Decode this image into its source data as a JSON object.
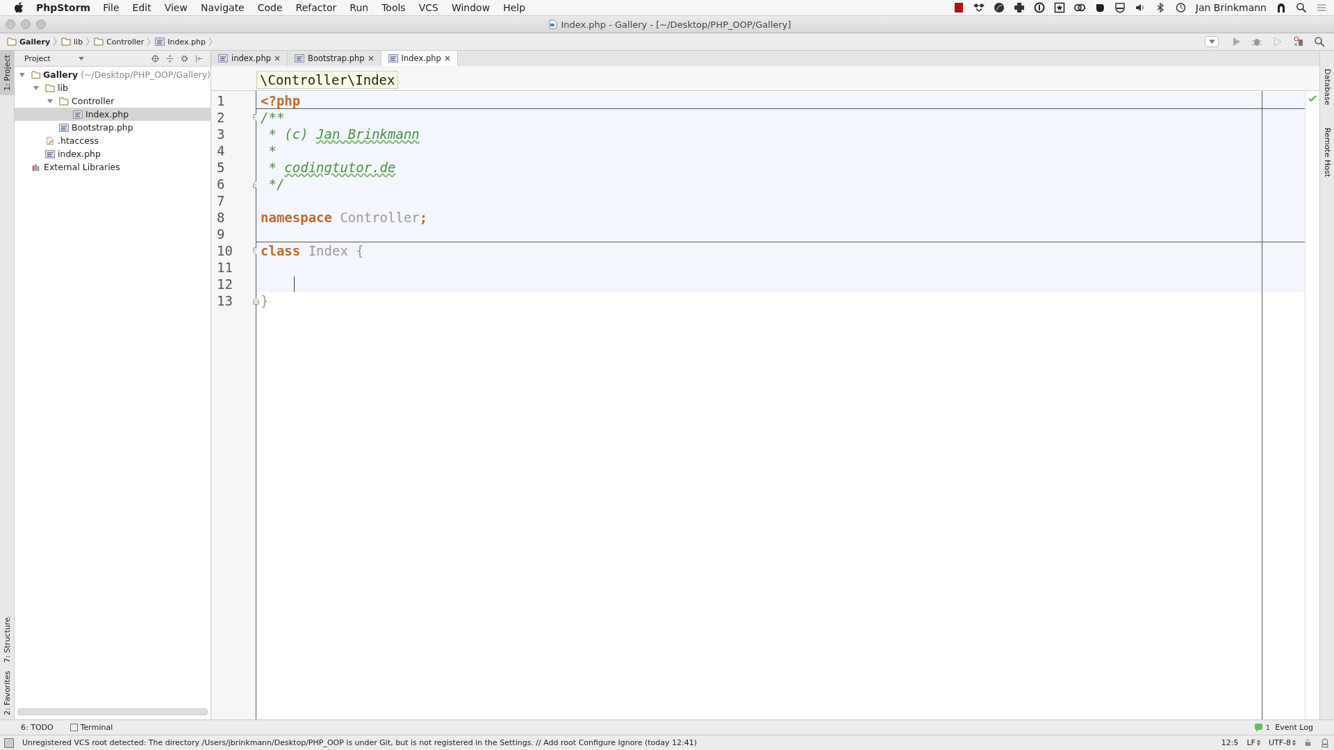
{
  "menu_bar": {
    "app": "PhpStorm",
    "menus": [
      "File",
      "Edit",
      "View",
      "Navigate",
      "Code",
      "Refactor",
      "Run",
      "Tools",
      "VCS",
      "Window",
      "Help"
    ],
    "user": "Jan Brinkmann"
  },
  "window": {
    "title": "Index.php - Gallery - [~/Desktop/PHP_OOP/Gallery]"
  },
  "breadcrumbs": [
    {
      "label": "Gallery",
      "bold": true
    },
    {
      "label": "lib",
      "bold": false
    },
    {
      "label": "Controller",
      "bold": false
    },
    {
      "label": "Index.php",
      "bold": false
    }
  ],
  "left_strip": [
    "1: Project",
    "7: Structure",
    "2: Favorites"
  ],
  "right_strip": [
    "Database",
    "Remote Host"
  ],
  "project_panel": {
    "view": "Project",
    "tree": [
      {
        "label": "Gallery",
        "hint": "(~/Desktop/PHP_OOP/Gallery)",
        "kind": "folder",
        "expanded": true,
        "selected": false,
        "children": [
          {
            "label": "lib",
            "kind": "folder",
            "expanded": true,
            "selected": false,
            "children": [
              {
                "label": "Controller",
                "kind": "folder",
                "expanded": true,
                "selected": false,
                "children": [
                  {
                    "label": "Index.php",
                    "kind": "php",
                    "selected": true
                  }
                ]
              },
              {
                "label": "Bootstrap.php",
                "kind": "php",
                "selected": false
              }
            ]
          },
          {
            "label": ".htaccess",
            "kind": "file",
            "selected": false
          },
          {
            "label": "index.php",
            "kind": "php",
            "selected": false
          }
        ]
      },
      {
        "label": "External Libraries",
        "kind": "library",
        "selected": false
      }
    ]
  },
  "tabs": [
    {
      "label": "index.php",
      "selected": false
    },
    {
      "label": "Bootstrap.php",
      "selected": false
    },
    {
      "label": "Index.php",
      "selected": true
    }
  ],
  "editor": {
    "scope": "\\Controller\\Index",
    "lines": [
      {
        "number": "1",
        "fold_start": false,
        "fold_end": false,
        "caret": false,
        "tokens": [
          {
            "text": "<?php",
            "kind": "keyword"
          }
        ]
      },
      {
        "number": "2",
        "fold_start": true,
        "fold_end": false,
        "caret": false,
        "tokens": [
          {
            "text": "/**",
            "kind": "comment"
          }
        ]
      },
      {
        "number": "3",
        "fold_start": false,
        "fold_end": false,
        "caret": false,
        "tokens": [
          {
            "text": " * (c) ",
            "kind": "comment"
          },
          {
            "text": "Jan Brinkmann",
            "kind": "typo"
          }
        ]
      },
      {
        "number": "4",
        "fold_start": false,
        "fold_end": false,
        "caret": false,
        "tokens": [
          {
            "text": " *",
            "kind": "comment"
          }
        ]
      },
      {
        "number": "5",
        "fold_start": false,
        "fold_end": false,
        "caret": false,
        "tokens": [
          {
            "text": " * ",
            "kind": "comment"
          },
          {
            "text": "codingtutor.de",
            "kind": "typo"
          }
        ]
      },
      {
        "number": "6",
        "fold_start": false,
        "fold_end": true,
        "caret": false,
        "tokens": [
          {
            "text": " */",
            "kind": "comment"
          }
        ]
      },
      {
        "number": "7",
        "fold_start": false,
        "fold_end": false,
        "caret": false
      },
      {
        "number": "8",
        "fold_start": false,
        "fold_end": false,
        "caret": false,
        "tokens": [
          {
            "text": "namespace",
            "kind": "keyword"
          },
          {
            "text": " Controller",
            "kind": "name"
          },
          {
            "text": ";",
            "kind": "keyword"
          }
        ]
      },
      {
        "number": "9",
        "fold_start": false,
        "fold_end": false,
        "caret": false
      },
      {
        "number": "10",
        "fold_start": true,
        "fold_end": false,
        "caret": false,
        "tokens": [
          {
            "text": "class",
            "kind": "keyword"
          },
          {
            "text": " Index {",
            "kind": "name"
          }
        ]
      },
      {
        "number": "11",
        "fold_start": false,
        "fold_end": false,
        "caret": false
      },
      {
        "number": "12",
        "fold_start": false,
        "fold_end": false,
        "caret": true
      },
      {
        "number": "13",
        "fold_start": false,
        "fold_end": true,
        "caret": false,
        "tokens": [
          {
            "text": "}",
            "kind": "name"
          }
        ]
      }
    ]
  },
  "tool_bar": {
    "tools": [
      "6: TODO",
      "Terminal"
    ],
    "event_count": "1",
    "event_log": "Event Log"
  },
  "status_bar": {
    "message": "Unregistered VCS root detected: The directory /Users/jbrinkmann/Desktop/PHP_OOP is under Git, but is not registered in the Settings. // Add root  Configure  Ignore (today 12:41)",
    "position": "12:5",
    "line_sep": "LF",
    "encoding": "UTF-8"
  }
}
